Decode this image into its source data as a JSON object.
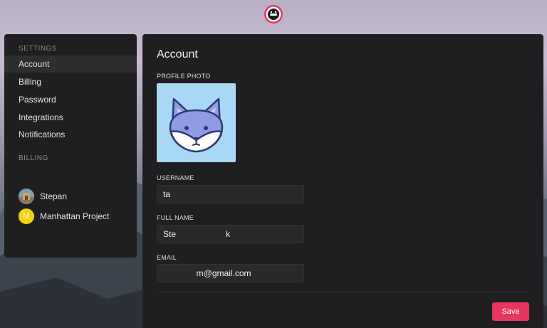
{
  "colors": {
    "panel": "#1f1f21",
    "active_item": "#2e2e31",
    "accent": "#e8365f",
    "input_bg": "#29292b",
    "photo_bg": "#a9d8f6",
    "org_avatar": "#f5d20f"
  },
  "header": {
    "logo_icon": "app-logo-icon"
  },
  "sidebar": {
    "settings_label": "SETTINGS",
    "items": [
      {
        "label": "Account",
        "active": true
      },
      {
        "label": "Billing",
        "active": false
      },
      {
        "label": "Password",
        "active": false
      },
      {
        "label": "Integrations",
        "active": false
      },
      {
        "label": "Notifications",
        "active": false
      }
    ],
    "billing_label": "BILLING",
    "orgs": [
      {
        "name": "Stepan",
        "avatar": "photo-avatar"
      },
      {
        "name": "Manhattan Project",
        "avatar": "letter-avatar",
        "initial": "M"
      }
    ]
  },
  "main": {
    "title": "Account",
    "profile_photo_label": "PROFILE PHOTO",
    "profile_photo_icon": "fox-avatar-icon",
    "username_label": "USERNAME",
    "username_value": "ta",
    "fullname_label": "FULL NAME",
    "fullname_value": "Ste                     k",
    "email_label": "EMAIL",
    "email_value": "              m@gmail.com",
    "save_label": "Save"
  }
}
